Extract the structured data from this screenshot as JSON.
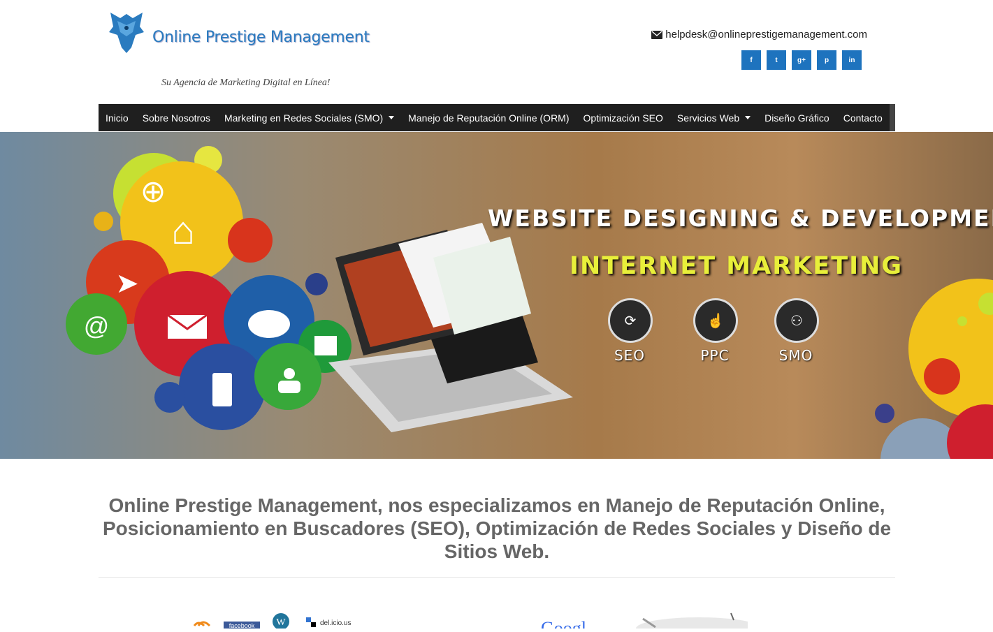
{
  "brand": {
    "name": "Online Prestige Management",
    "tagline": "Su Agencia de Marketing Digital en Línea!"
  },
  "contact": {
    "email": "helpdesk@onlineprestigemanagement.com",
    "icon": "envelope-icon"
  },
  "socials": [
    {
      "name": "facebook",
      "glyph": "f"
    },
    {
      "name": "twitter",
      "glyph": "t"
    },
    {
      "name": "google-plus",
      "glyph": "g+"
    },
    {
      "name": "pinterest",
      "glyph": "p"
    },
    {
      "name": "linkedin",
      "glyph": "in"
    }
  ],
  "nav": {
    "items": [
      {
        "label": "Inicio",
        "dropdown": false
      },
      {
        "label": "Sobre Nosotros",
        "dropdown": false
      },
      {
        "label": "Marketing en Redes Sociales (SMO)",
        "dropdown": true
      },
      {
        "label": "Manejo de Reputación Online (ORM)",
        "dropdown": false
      },
      {
        "label": "Optimización SEO",
        "dropdown": false
      },
      {
        "label": "Servicios Web",
        "dropdown": true
      },
      {
        "label": "Diseño Gráfico",
        "dropdown": false
      },
      {
        "label": "Contacto",
        "dropdown": false
      }
    ]
  },
  "banner": {
    "title": "WEBSITE DESIGNING & DEVELOPMENT",
    "subtitle": "INTERNET MARKETING",
    "services": [
      {
        "label": "SEO",
        "icon": "seo-chart-icon"
      },
      {
        "label": "PPC",
        "icon": "touch-icon"
      },
      {
        "label": "SMO",
        "icon": "social-network-icon"
      }
    ]
  },
  "headline": "Online Prestige Management, nos especializamos en Manejo de Reputación Online, Posicionamiento en Buscadores (SEO), Optimización de Redes Sociales y Diseño de Sitios Web.",
  "strip": {
    "left_labels": [
      "facebook",
      "del.icio.us"
    ],
    "right_label": "Googl"
  },
  "colors": {
    "accent": "#1e73be",
    "nav_bg": "#1f1f1f",
    "subtitle_yellow": "#e8ef3a",
    "headline_gray": "#666666"
  }
}
